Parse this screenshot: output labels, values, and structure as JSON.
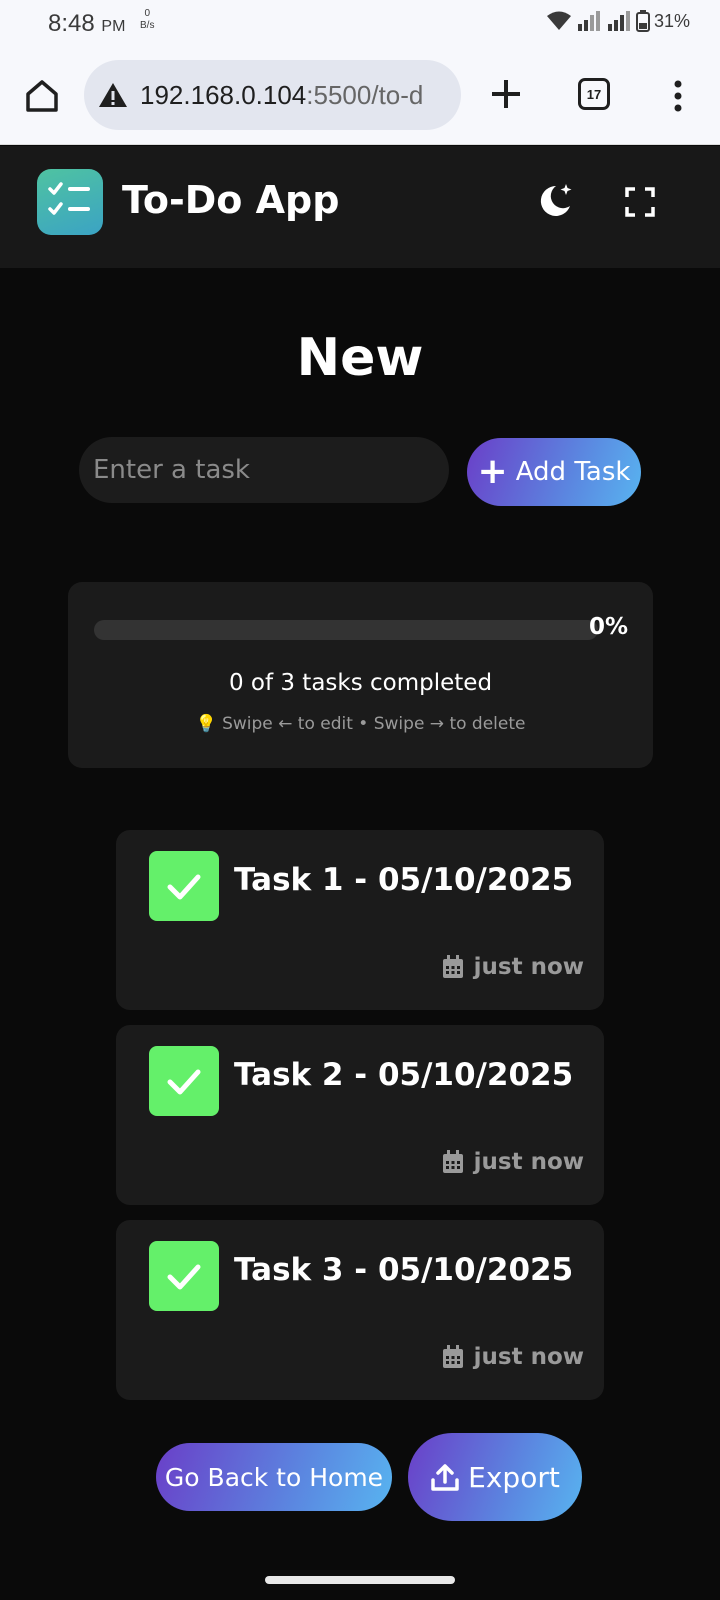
{
  "status_bar": {
    "time": "8:48",
    "ampm": "PM",
    "net_speed_value": "0",
    "net_speed_unit": "B/s",
    "battery": "31%"
  },
  "browser": {
    "url_host": "192.168.0.104",
    "url_rest": ":5500/to-d",
    "tab_count": "17"
  },
  "app": {
    "title": "To-Do App"
  },
  "main": {
    "page_title": "New",
    "task_input_placeholder": "Enter a task",
    "add_button_label": "Add Task"
  },
  "progress": {
    "percent_label": "0%",
    "percent_value": 0,
    "summary": "0 of 3 tasks completed",
    "hint": "💡 Swipe ← to edit • Swipe → to delete"
  },
  "tasks": [
    {
      "title": "Task 1 - 05/10/2025",
      "time": "just now",
      "completed_icon": "check-icon"
    },
    {
      "title": "Task 2 - 05/10/2025",
      "time": "just now",
      "completed_icon": "check-icon"
    },
    {
      "title": "Task 3 - 05/10/2025",
      "time": "just now",
      "completed_icon": "check-icon"
    }
  ],
  "footer": {
    "home_label": "Go Back to Home",
    "export_label": "Export"
  },
  "colors": {
    "background": "#0a0a0a",
    "card": "#1b1b1b",
    "check_green": "#64f06a",
    "gradient_start": "#6a3fc8",
    "gradient_end": "#58b4f0"
  }
}
